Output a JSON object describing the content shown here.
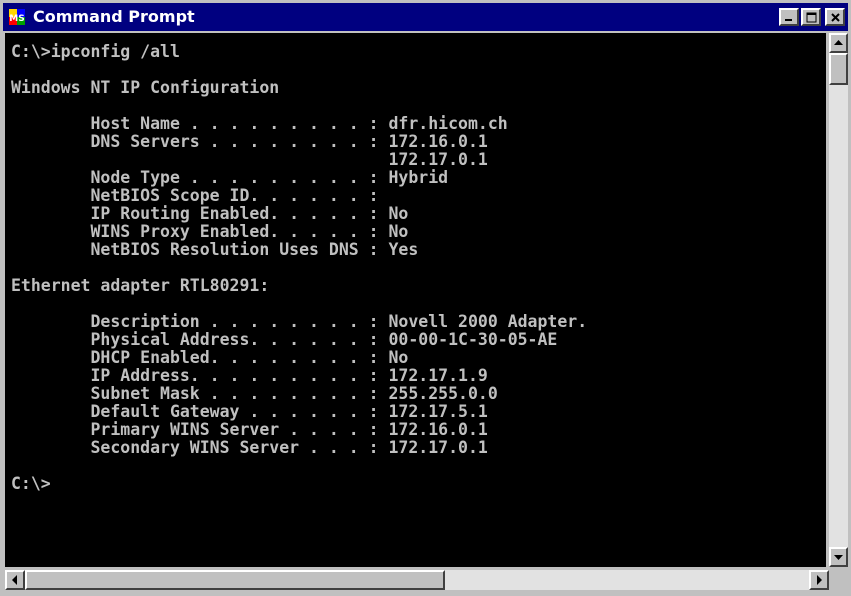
{
  "window": {
    "title": "Command Prompt",
    "icon": "ms-dos-icon",
    "icon_label": "MS",
    "controls": [
      "minimize-icon",
      "maximize-icon",
      "close-icon"
    ]
  },
  "colors": {
    "titlebar": "#000080",
    "console_bg": "#000000",
    "console_text": "#c0c0c0"
  },
  "console": {
    "lines": [
      "C:\\>ipconfig /all",
      "",
      "Windows NT IP Configuration",
      "",
      "        Host Name . . . . . . . . . : dfr.hicom.ch",
      "        DNS Servers . . . . . . . . : 172.16.0.1",
      "                                      172.17.0.1",
      "        Node Type . . . . . . . . . : Hybrid",
      "        NetBIOS Scope ID. . . . . . :",
      "        IP Routing Enabled. . . . . : No",
      "        WINS Proxy Enabled. . . . . : No",
      "        NetBIOS Resolution Uses DNS : Yes",
      "",
      "Ethernet adapter RTL80291:",
      "",
      "        Description . . . . . . . . : Novell 2000 Adapter.",
      "        Physical Address. . . . . . : 00-00-1C-30-05-AE",
      "        DHCP Enabled. . . . . . . . : No",
      "        IP Address. . . . . . . . . : 172.17.1.9",
      "        Subnet Mask . . . . . . . . : 255.255.0.0",
      "        Default Gateway . . . . . . : 172.17.5.1",
      "        Primary WINS Server . . . . : 172.16.0.1",
      "        Secondary WINS Server . . . : 172.17.0.1",
      "",
      "C:\\>"
    ]
  },
  "scrollbars": {
    "vertical": {
      "position": 0.0
    },
    "horizontal": {
      "position": 0.0
    }
  }
}
